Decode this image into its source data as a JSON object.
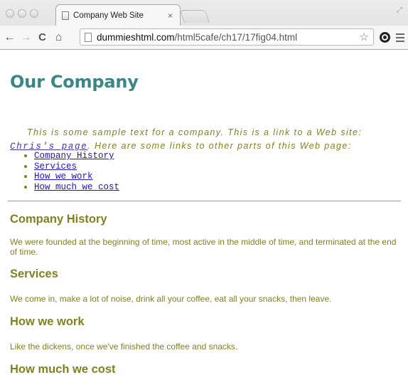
{
  "browser": {
    "tab": {
      "title": "Company Web Site",
      "close": "×"
    },
    "toolbar": {
      "back": "←",
      "forward": "→",
      "reload": "C",
      "home": "⌂"
    },
    "address": {
      "host": "dummieshtml.com",
      "path": "/html5cafe/ch17/17fig04.html"
    },
    "star": "☆"
  },
  "page": {
    "title": "Our Company",
    "intro": {
      "line1": "This is some sample text for a company. This is a link to a Web site:",
      "link_text": "Chris's page",
      "line2_tail": ". Here are some links to other parts of this Web page:"
    },
    "toc": [
      "Company History",
      "Services",
      "How we work",
      "How much we cost"
    ],
    "sections": [
      {
        "heading": "Company History",
        "text": "We were founded at the beginning of time, most active in the middle of time, and terminated at the end of time."
      },
      {
        "heading": "Services",
        "text": "We come in, make a lot of noise, drink all your coffee, eat all your snacks, then leave."
      },
      {
        "heading": "How we work",
        "text": "Like the dickens, once we've finished the coffee and snacks."
      },
      {
        "heading": "How much we cost",
        "text": ""
      }
    ]
  },
  "colors": {
    "heading_teal": "#3a8585",
    "body_olive": "#818120",
    "link_blue": "#2211cc"
  }
}
